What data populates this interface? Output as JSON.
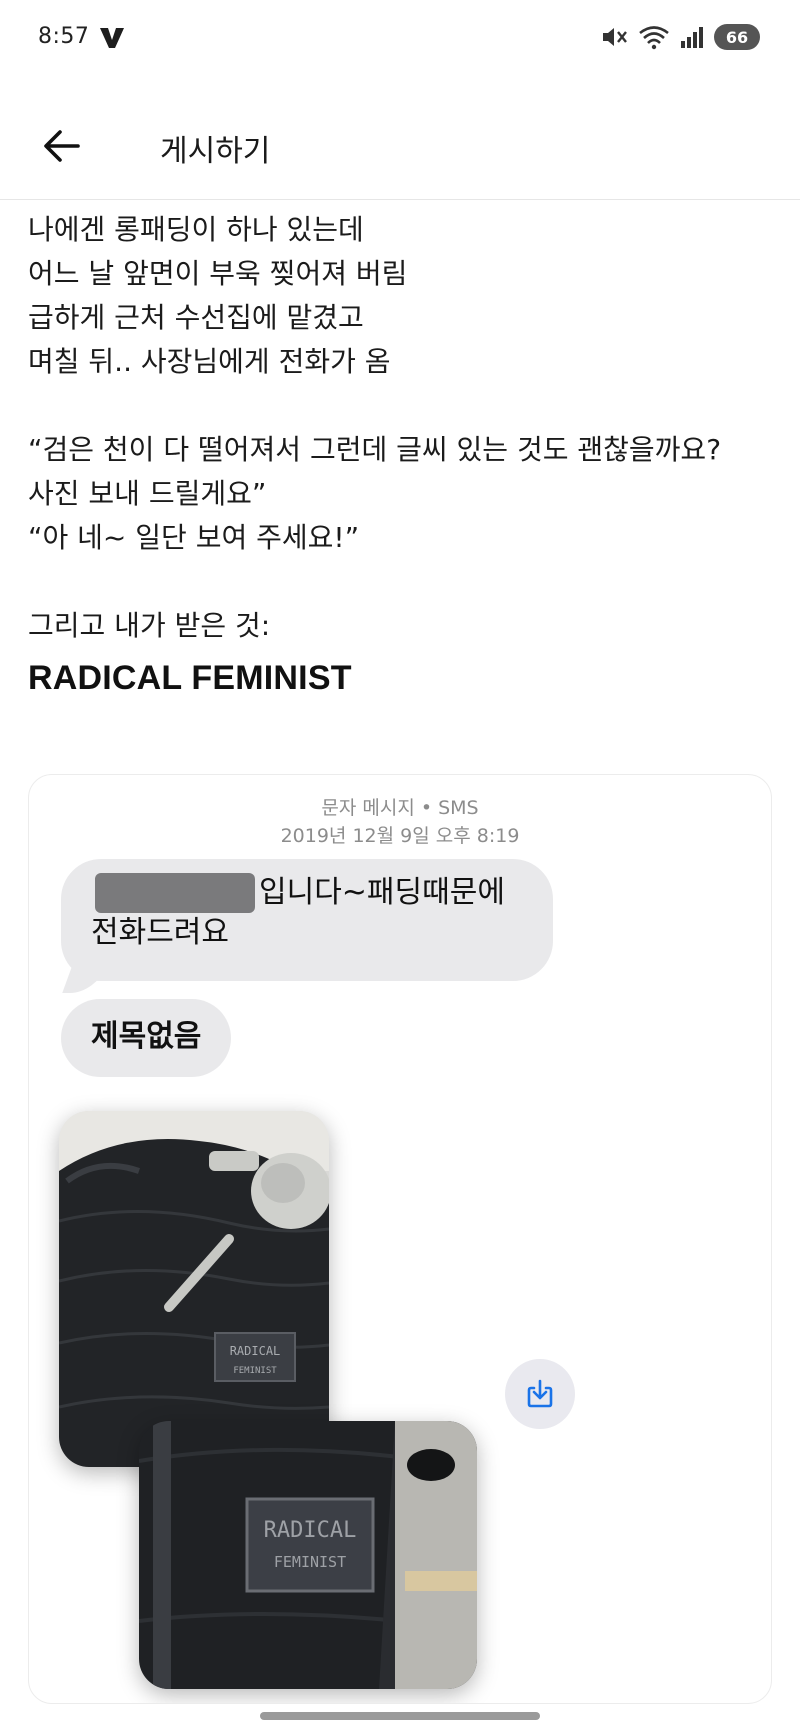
{
  "status_bar": {
    "time": "8:57",
    "battery": "66",
    "icons": [
      "v-app-icon",
      "mute-icon",
      "wifi-icon",
      "signal-icon",
      "battery-icon"
    ]
  },
  "header": {
    "title": "게시하기",
    "back_icon": "back-arrow-icon"
  },
  "post": {
    "lines": [
      "나에겐 롱패딩이 하나 있는데",
      "어느 날 앞면이 부욱 찢어져 버림",
      "급하게 근처 수선집에 맡겼고",
      "며칠 뒤.. 사장님에게 전화가 옴",
      "",
      "“검은 천이 다 떨어져서 그런데 글씨 있는 것도 괜찮을까요?",
      "사진 보내 드릴게요”",
      "“아 네~ 일단 보여 주세요!”",
      "",
      "그리고 내가 받은 것:"
    ],
    "emphasis": "RADICAL FEMINIST"
  },
  "sms_screenshot": {
    "meta_line_1": "문자 메시지 • SMS",
    "meta_line_2": "2019년 12월 9일 오후 8:19",
    "bubble_1_after_redaction": "입니다~패딩때문에",
    "bubble_1_line_2": "전화드려요",
    "bubble_2": "제목없음",
    "photo_patch_line_1": "RADICAL",
    "photo_patch_line_2": "FEMINIST",
    "save_icon": "download-icon"
  },
  "colors": {
    "bubble": "#e9e9eb",
    "accent_blue": "#1a73e8",
    "jacket": "#1f2124"
  }
}
